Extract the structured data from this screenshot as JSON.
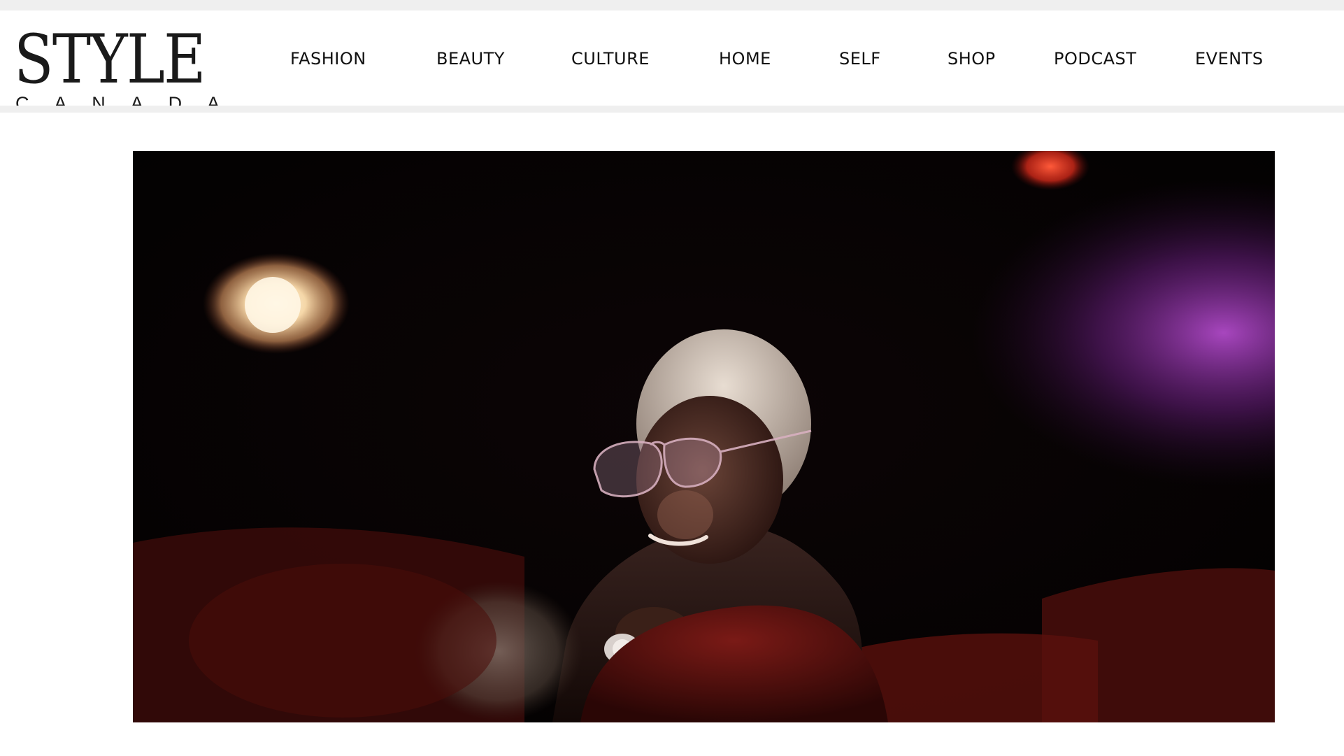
{
  "header": {
    "logo": {
      "title": "STYLE",
      "subtitle_letters": [
        "C",
        "A",
        "N",
        "A",
        "D",
        "A"
      ]
    },
    "nav": [
      {
        "label": "FASHION"
      },
      {
        "label": "BEAUTY"
      },
      {
        "label": "CULTURE"
      },
      {
        "label": "HOME"
      },
      {
        "label": "SELF"
      },
      {
        "label": "SHOP"
      },
      {
        "label": "PODCAST"
      },
      {
        "label": "EVENTS"
      }
    ]
  },
  "hero": {
    "description": "Photo of a smiling woman in tinted aviator glasses seated in a dark theatre with red seats",
    "colors": {
      "background": "#050203",
      "seat_red": "#5a0d0d",
      "purple_glow": "#8a2aa0",
      "warm_light": "#fff1d8"
    }
  },
  "theme": {
    "strip_gray": "#efefef",
    "text": "#111111"
  }
}
